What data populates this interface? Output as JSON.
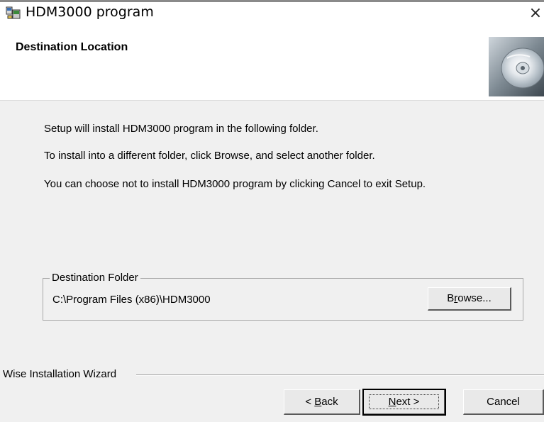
{
  "window": {
    "title": "HDM3000 program",
    "close_glyph": "×"
  },
  "header": {
    "title": "Destination Location"
  },
  "body": {
    "line1": "Setup will install HDM3000 program in the following folder.",
    "line2": "To install into a different folder, click Browse, and select another folder.",
    "line3": "You can choose not to install HDM3000 program by clicking Cancel to exit Setup."
  },
  "destination": {
    "legend": "Destination Folder",
    "path": "C:\\Program Files (x86)\\HDM3000",
    "browse_label_pre": "B",
    "browse_label_u": "r",
    "browse_label_post": "owse..."
  },
  "footer": {
    "wizard_label": "Wise Installation Wizard",
    "back_pre": "< ",
    "back_u": "B",
    "back_post": "ack",
    "next_u": "N",
    "next_post": "ext >",
    "cancel_label": "Cancel"
  },
  "icons": {
    "title_icon": "installer-icon",
    "header_icon": "cd-disc-icon"
  },
  "colors": {
    "dialog_bg": "#f0f0f0",
    "header_bg": "#ffffff"
  }
}
